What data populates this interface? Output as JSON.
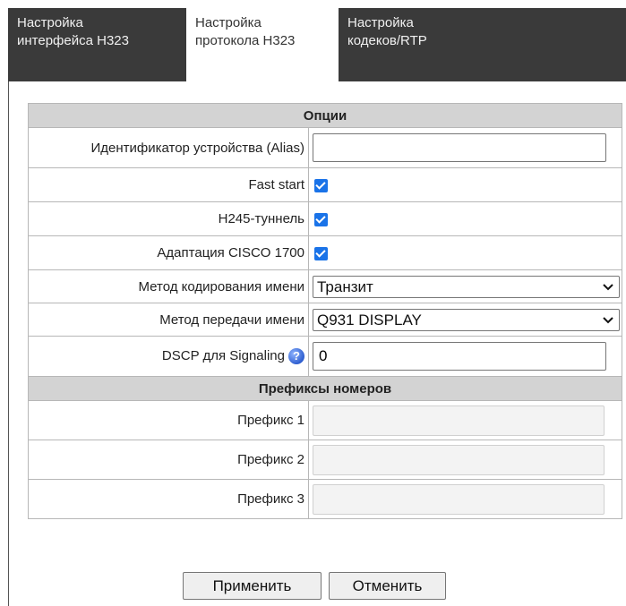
{
  "tabs": [
    {
      "line1": "Настройка",
      "line2": "интерфейса H323",
      "active": false
    },
    {
      "line1": "Настройка",
      "line2": "протокола H323",
      "active": true
    },
    {
      "line1": "Настройка",
      "line2": "кодеков/RTP",
      "active": false
    }
  ],
  "options": {
    "header": "Опции",
    "alias_label": "Идентификатор устройства (Alias)",
    "alias_value": "",
    "fast_start_label": "Fast start",
    "fast_start_checked": true,
    "h245_label": "H245-туннель",
    "h245_checked": true,
    "cisco_label": "Адаптация CISCO 1700",
    "cisco_checked": true,
    "name_coding_label": "Метод кодирования имени",
    "name_coding_value": "Транзит",
    "name_transfer_label": "Метод передачи имени",
    "name_transfer_value": "Q931 DISPLAY",
    "dscp_label": "DSCP для Signaling",
    "dscp_value": "0"
  },
  "prefixes": {
    "header": "Префиксы номеров",
    "items": [
      {
        "label": "Префикс 1",
        "value": ""
      },
      {
        "label": "Префикс 2",
        "value": ""
      },
      {
        "label": "Префикс 3",
        "value": ""
      }
    ]
  },
  "buttons": {
    "apply": "Применить",
    "cancel": "Отменить"
  },
  "colors": {
    "tab_bar": "#3a3a3a",
    "section_header": "#d3d3d3",
    "checkbox": "#1a73e8"
  }
}
